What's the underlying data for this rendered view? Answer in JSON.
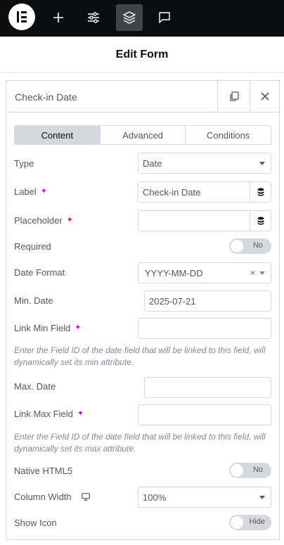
{
  "topbar": {
    "logo_icon": "elementor-logo-icon",
    "items": [
      {
        "icon": "plus-icon"
      },
      {
        "icon": "sliders-icon"
      },
      {
        "icon": "layers-icon",
        "active": true
      },
      {
        "icon": "chat-icon"
      }
    ]
  },
  "header": {
    "title": "Edit Form"
  },
  "panel": {
    "title": "Check-in Date",
    "copy_icon": "copy-icon",
    "close_icon": "close-icon"
  },
  "tabs": [
    {
      "label": "Content",
      "active": true
    },
    {
      "label": "Advanced"
    },
    {
      "label": "Conditions"
    }
  ],
  "fields": {
    "type": {
      "label": "Type",
      "value": "Date"
    },
    "label": {
      "label": "Label",
      "value": "Check-in Date"
    },
    "placeholder": {
      "label": "Placeholder",
      "value": ""
    },
    "required": {
      "label": "Required",
      "toggle": "No"
    },
    "date_format": {
      "label": "Date Format",
      "value": "YYYY-MM-DD",
      "clear": "×"
    },
    "min_date": {
      "label": "Min. Date",
      "value": "2025-07-21"
    },
    "link_min": {
      "label": "Link Min Field",
      "value": "",
      "help": "Enter the Field ID of the date field that will be linked to this field, will dynamically set its min attribute."
    },
    "max_date": {
      "label": "Max. Date",
      "value": ""
    },
    "link_max": {
      "label": "Link Max Field",
      "value": "",
      "help": "Enter the Field ID of the date field that will be linked to this field, will dynamically set its max attribute."
    },
    "native_html5": {
      "label": "Native HTML5",
      "toggle": "No"
    },
    "column_width": {
      "label": "Column Width",
      "value": "100%",
      "device_icon": "desktop-icon"
    },
    "show_icon": {
      "label": "Show Icon",
      "toggle": "Hide"
    }
  },
  "colors": {
    "topbar_bg": "#0c0d0e",
    "ai_accent": "#c00bb9",
    "border": "#d5d8dc"
  }
}
